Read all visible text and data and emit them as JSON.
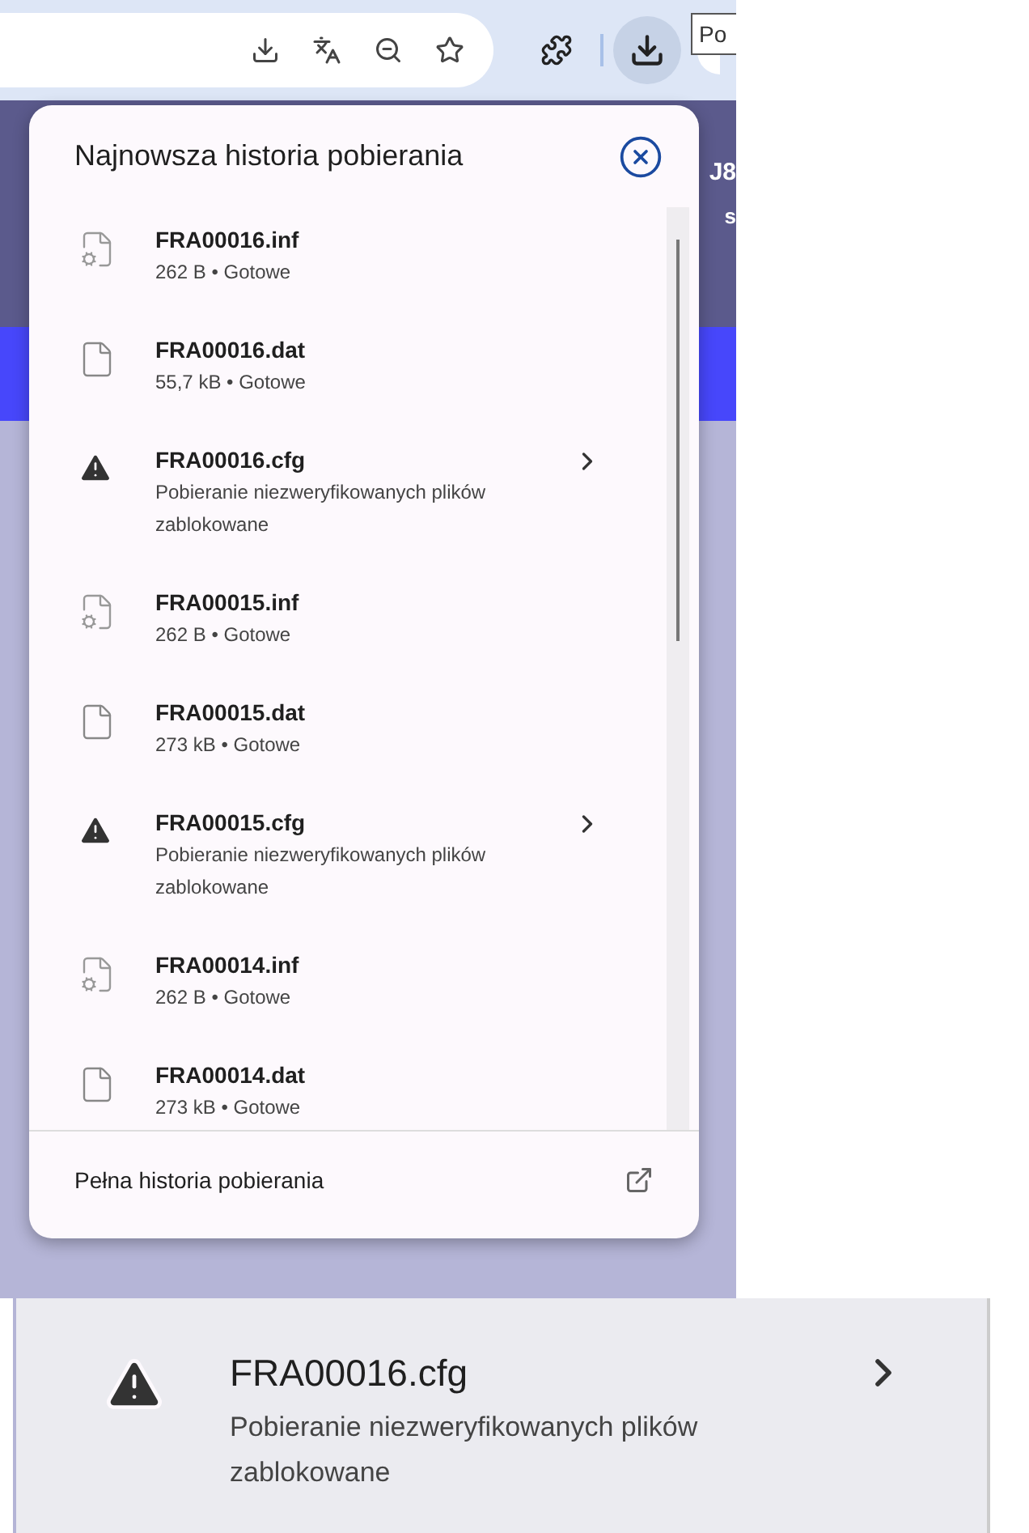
{
  "toolbar": {
    "downloads_selected": true
  },
  "tooltip": {
    "text": "Po"
  },
  "page": {
    "texts": [
      "J8",
      "s"
    ]
  },
  "popup": {
    "title": "Najnowsza historia pobierania",
    "items": [
      {
        "kind": "settings_file",
        "name": "FRA00016.inf",
        "status": "262 B • Gotowe"
      },
      {
        "kind": "file",
        "name": "FRA00016.dat",
        "status": "55,7 kB • Gotowe"
      },
      {
        "kind": "blocked",
        "name": "FRA00016.cfg",
        "status": "Pobieranie niezweryfikowanych plików zablokowane"
      },
      {
        "kind": "settings_file",
        "name": "FRA00015.inf",
        "status": "262 B • Gotowe"
      },
      {
        "kind": "file",
        "name": "FRA00015.dat",
        "status": "273 kB • Gotowe"
      },
      {
        "kind": "blocked",
        "name": "FRA00015.cfg",
        "status": "Pobieranie niezweryfikowanych plików zablokowane"
      },
      {
        "kind": "settings_file",
        "name": "FRA00014.inf",
        "status": "262 B • Gotowe"
      },
      {
        "kind": "file",
        "name": "FRA00014.dat",
        "status": "273 kB • Gotowe"
      }
    ],
    "footer": "Pełna historia pobierania"
  },
  "detail": {
    "kind": "blocked",
    "name": "FRA00016.cfg",
    "status": "Pobieranie niezweryfikowanych plików zablokowane"
  }
}
